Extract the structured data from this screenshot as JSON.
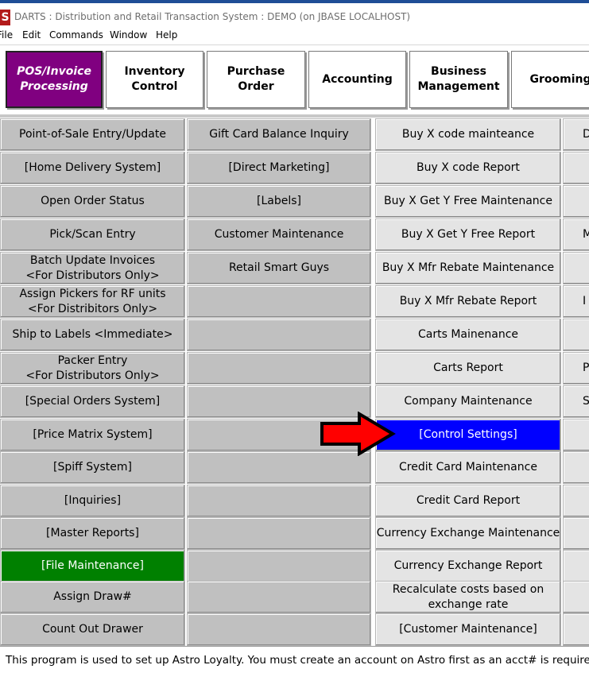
{
  "window": {
    "app_icon_letter": "S",
    "title": "DARTS : Distribution and Retail Transaction System : DEMO (on JBASE LOCALHOST)"
  },
  "menu": [
    "File",
    "Edit",
    "Commands",
    "Window",
    "Help"
  ],
  "tabs": [
    {
      "label": "POS/Invoice\nProcessing",
      "active": true
    },
    {
      "label": "Inventory\nControl",
      "active": false
    },
    {
      "label": "Purchase Order",
      "active": false
    },
    {
      "label": "Accounting",
      "active": false
    },
    {
      "label": "Business\nManagement",
      "active": false
    },
    {
      "label": "Grooming",
      "active": false
    }
  ],
  "columns": [
    [
      "Point-of-Sale Entry/Update",
      "[Home Delivery System]",
      "Open Order Status",
      "Pick/Scan Entry",
      "Batch Update Invoices\n<For Distributors Only>",
      "Assign Pickers for RF units\n<For Distribitors Only>",
      "Ship to Labels <Immediate>",
      "Packer Entry\n<For Distributors Only>",
      "[Special Orders System]",
      "[Price Matrix System]",
      "[Spiff System]",
      "[Inquiries]",
      "[Master Reports]",
      "[File Maintenance]",
      "Assign Draw#",
      "Count Out Drawer"
    ],
    [
      "Gift Card Balance Inquiry",
      "[Direct Marketing]",
      "[Labels]",
      "Customer Maintenance",
      "Retail Smart Guys",
      "",
      "",
      "",
      "",
      "",
      "",
      "",
      "",
      "",
      "",
      ""
    ],
    [
      "Buy X code mainteance",
      "Buy X code Report",
      "Buy X Get Y Free Maintenance",
      "Buy X Get Y Free Report",
      "Buy X Mfr Rebate Maintenance",
      "Buy X Mfr Rebate Report",
      "Carts Mainenance",
      "Carts Report",
      "Company Maintenance",
      "[Control Settings]",
      "Credit Card Maintenance",
      "Credit Card Report",
      "Currency Exchange Maintenance",
      "Currency Exchange Report",
      "Recalculate costs based on\nexchange rate",
      "[Customer Maintenance]"
    ],
    [
      "D",
      "",
      "",
      "M",
      "",
      "I",
      "",
      "Pi",
      "Sa",
      "",
      "",
      "",
      "",
      "",
      "",
      ""
    ]
  ],
  "highlight": {
    "column": 2,
    "row": 9,
    "color": "#0000ff"
  },
  "selected": {
    "column": 0,
    "row": 13,
    "color": "#008000"
  },
  "active_tab_color": "#800080",
  "arrow_color": "#ff0000",
  "status": "This program is used to set up Astro Loyalty. You must create an account on Astro first as an acct# is required."
}
